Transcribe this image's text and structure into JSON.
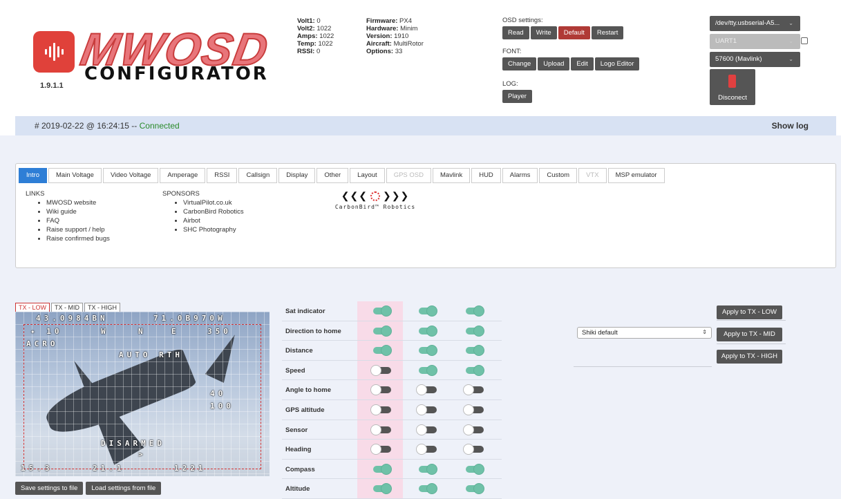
{
  "header": {
    "logo_title": "MWOSD",
    "logo_subtitle": "CONFIGURATOR",
    "version": "1.9.1.1",
    "stats_left": [
      {
        "label": "Volt1:",
        "value": "0"
      },
      {
        "label": "Volt2:",
        "value": "1022"
      },
      {
        "label": "Amps:",
        "value": "1022"
      },
      {
        "label": "Temp:",
        "value": "1022"
      },
      {
        "label": "RSSI:",
        "value": "0"
      }
    ],
    "stats_right": [
      {
        "label": "Firmware:",
        "value": "PX4"
      },
      {
        "label": "Hardware:",
        "value": "Minim"
      },
      {
        "label": "Version:",
        "value": "1910"
      },
      {
        "label": "Aircraft:",
        "value": "MultiRotor"
      },
      {
        "label": "Options:",
        "value": "33"
      }
    ],
    "osd_settings_label": "OSD settings:",
    "osd_buttons": [
      "Read",
      "Write",
      "Default",
      "Restart"
    ],
    "font_label": "FONT:",
    "font_buttons": [
      "Change",
      "Upload",
      "Edit",
      "Logo Editor"
    ],
    "log_label": "LOG:",
    "log_button": "Player",
    "port": "/dev/tty.usbserial-A5...",
    "uart": "UART1",
    "baud": "57600 (Mavlink)",
    "connect_label": "Disconect"
  },
  "status": {
    "timestamp": "# 2019-02-22 @ 16:24:15 --",
    "state": "Connected",
    "show_log": "Show log"
  },
  "tabs": [
    {
      "label": "Intro",
      "state": "active"
    },
    {
      "label": "Main Voltage",
      "state": ""
    },
    {
      "label": "Video Voltage",
      "state": ""
    },
    {
      "label": "Amperage",
      "state": ""
    },
    {
      "label": "RSSI",
      "state": ""
    },
    {
      "label": "Callsign",
      "state": ""
    },
    {
      "label": "Display",
      "state": ""
    },
    {
      "label": "Other",
      "state": ""
    },
    {
      "label": "Layout",
      "state": ""
    },
    {
      "label": "GPS OSD",
      "state": "disabled"
    },
    {
      "label": "Mavlink",
      "state": ""
    },
    {
      "label": "HUD",
      "state": ""
    },
    {
      "label": "Alarms",
      "state": ""
    },
    {
      "label": "Custom",
      "state": ""
    },
    {
      "label": "VTX",
      "state": "disabled"
    },
    {
      "label": "MSP emulator",
      "state": ""
    }
  ],
  "intro": {
    "links_title": "LINKS",
    "links": [
      "MWOSD website",
      "Wiki guide",
      "FAQ",
      "Raise support / help",
      "Raise confirmed bugs"
    ],
    "sponsors_title": "SPONSORS",
    "sponsors": [
      "VirtualPilot.co.uk",
      "CarbonBird Robotics",
      "Airbot",
      "SHC Photography"
    ],
    "sponsor_logo_text": "CarbonBird™ Robotics"
  },
  "tx_tabs": [
    "TX - LOW",
    "TX - MID",
    "TX - HIGH"
  ],
  "osd_overlay": {
    "lat": "43.0984BN",
    "lon": "71.0B970W",
    "sats": "10",
    "dir_w": "W",
    "dir_n": "N",
    "dir_e": "E",
    "heading": "350",
    "mode": "ACRO",
    "flight_mode": "AUTO RTH",
    "alt": "40",
    "speed": "100",
    "armed": "DISARMED",
    "bottom_left": "15.3",
    "bottom_mid": "21.1",
    "bottom_right": "1221"
  },
  "save_buttons": [
    "Save settings to file",
    "Load settings from file"
  ],
  "features": [
    {
      "label": "Sat indicator",
      "states": [
        true,
        true,
        true
      ]
    },
    {
      "label": "Direction to home",
      "states": [
        true,
        true,
        true
      ]
    },
    {
      "label": "Distance",
      "states": [
        true,
        true,
        true
      ]
    },
    {
      "label": "Speed",
      "states": [
        false,
        true,
        true
      ]
    },
    {
      "label": "Angle to home",
      "states": [
        false,
        false,
        false
      ]
    },
    {
      "label": "GPS altitude",
      "states": [
        false,
        false,
        false
      ]
    },
    {
      "label": "Sensor",
      "states": [
        false,
        false,
        false
      ]
    },
    {
      "label": "Heading",
      "states": [
        false,
        false,
        false
      ]
    },
    {
      "label": "Compass",
      "states": [
        true,
        true,
        true
      ]
    },
    {
      "label": "Altitude",
      "states": [
        true,
        true,
        true
      ]
    }
  ],
  "layout": {
    "preset": "Shiki default",
    "apply_buttons": [
      "Apply to TX - LOW",
      "Apply to TX - MID",
      "Apply to TX - HIGH"
    ]
  },
  "colors": {
    "accent": "#2e7ed6",
    "connected": "#2a8a2a",
    "toggle_on": "#6fc1a8",
    "danger": "#b03a36",
    "logo": "#e0413a"
  }
}
